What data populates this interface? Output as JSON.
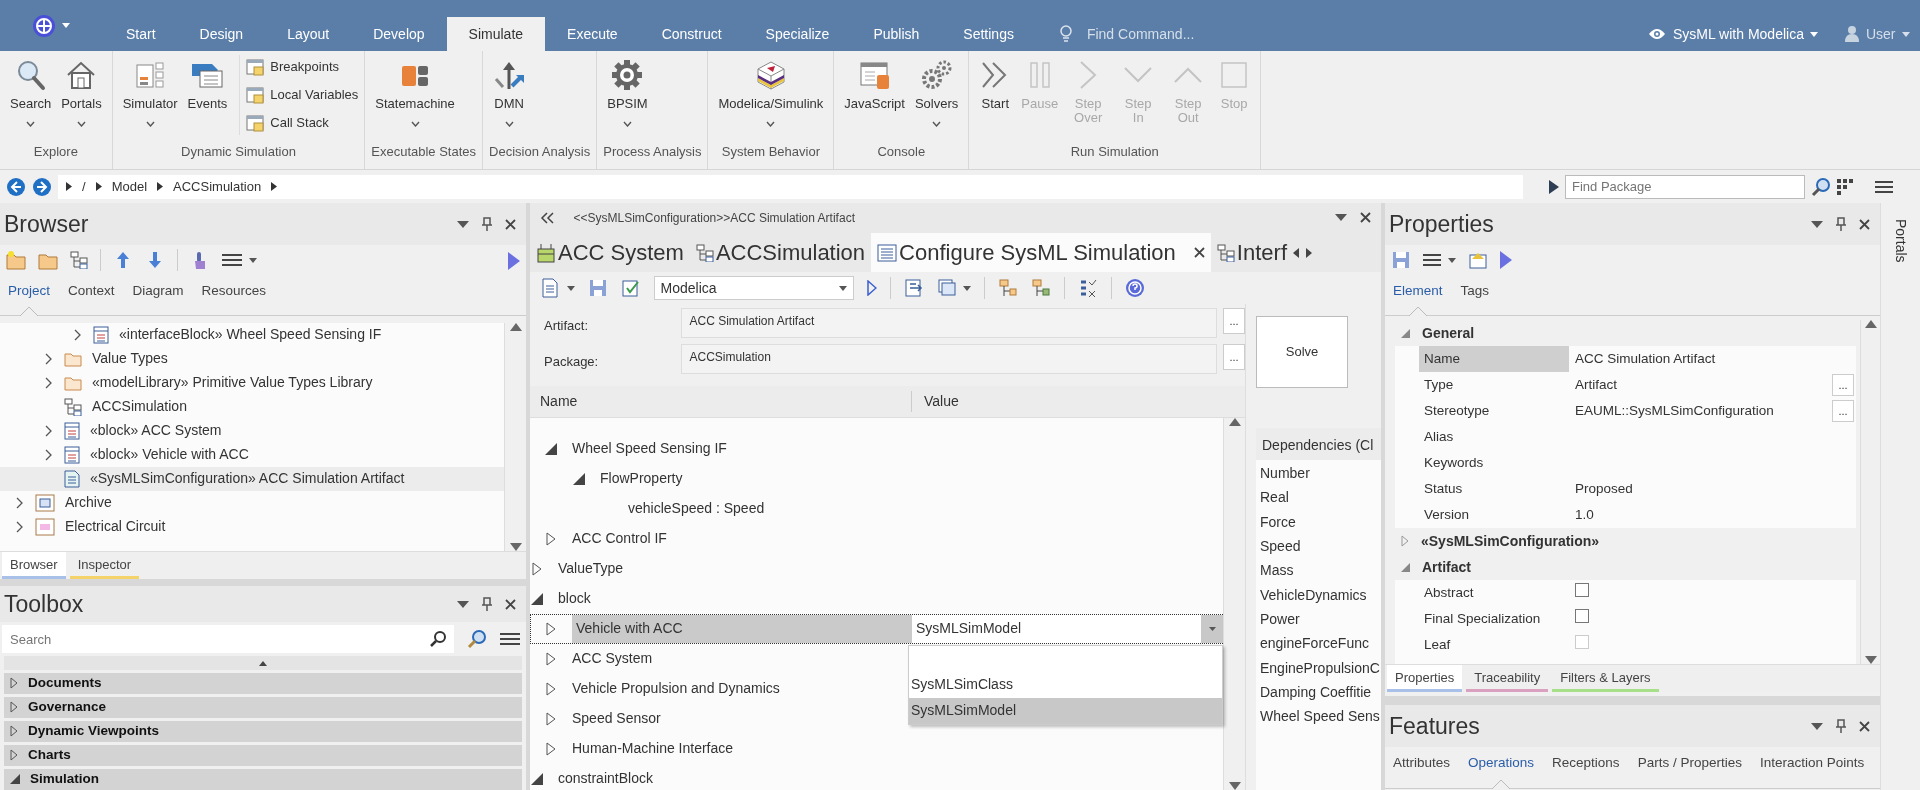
{
  "ribbon_tabs": [
    {
      "label": "Start",
      "selected": false
    },
    {
      "label": "Design",
      "selected": false
    },
    {
      "label": "Layout",
      "selected": false
    },
    {
      "label": "Develop",
      "selected": false
    },
    {
      "label": "Simulate",
      "selected": true
    },
    {
      "label": "Execute",
      "selected": false
    },
    {
      "label": "Construct",
      "selected": false
    },
    {
      "label": "Specialize",
      "selected": false
    },
    {
      "label": "Publish",
      "selected": false
    },
    {
      "label": "Settings",
      "selected": false
    }
  ],
  "find_command": {
    "placeholder": "Find Command..."
  },
  "perspective": "SysML with Modelica",
  "user": "User",
  "ribbon_groups": [
    {
      "label": "Explore",
      "items": [
        {
          "label": "Search",
          "kind": "large",
          "dropdown": true,
          "disabled": false
        },
        {
          "label": "Portals",
          "kind": "large",
          "dropdown": true,
          "disabled": false
        }
      ]
    },
    {
      "label": "Dynamic Simulation",
      "items": [
        {
          "label": "Simulator",
          "kind": "large",
          "dropdown": true,
          "disabled": false
        },
        {
          "label": "Events",
          "kind": "large",
          "dropdown": false,
          "disabled": false
        },
        {
          "label": "Breakpoints",
          "kind": "small",
          "disabled": false
        },
        {
          "label": "Local Variables",
          "kind": "small",
          "disabled": false
        },
        {
          "label": "Call Stack",
          "kind": "small",
          "disabled": false
        }
      ]
    },
    {
      "label": "Executable States",
      "items": [
        {
          "label": "Statemachine",
          "kind": "large",
          "dropdown": true,
          "disabled": false
        }
      ]
    },
    {
      "label": "Decision Analysis",
      "items": [
        {
          "label": "DMN",
          "kind": "large",
          "dropdown": true,
          "disabled": false
        }
      ]
    },
    {
      "label": "Process Analysis",
      "items": [
        {
          "label": "BPSIM",
          "kind": "large",
          "dropdown": true,
          "disabled": false
        }
      ]
    },
    {
      "label": "System Behavior",
      "items": [
        {
          "label": "Modelica/Simulink",
          "kind": "large",
          "dropdown": true,
          "disabled": false
        }
      ]
    },
    {
      "label": "Console",
      "items": [
        {
          "label": "JavaScript",
          "kind": "large",
          "dropdown": false,
          "disabled": false
        },
        {
          "label": "Solvers",
          "kind": "large",
          "dropdown": true,
          "disabled": false
        }
      ]
    },
    {
      "label": "Run Simulation",
      "items": [
        {
          "label": "Start",
          "kind": "large",
          "dropdown": false,
          "disabled": false
        },
        {
          "label": "Pause",
          "kind": "large",
          "dropdown": false,
          "disabled": true
        },
        {
          "label": "Step Over",
          "kind": "large",
          "dropdown": false,
          "disabled": true
        },
        {
          "label": "Step In",
          "kind": "large",
          "dropdown": false,
          "disabled": true
        },
        {
          "label": "Step Out",
          "kind": "large",
          "dropdown": false,
          "disabled": true
        },
        {
          "label": "Stop",
          "kind": "large",
          "dropdown": false,
          "disabled": true
        }
      ]
    }
  ],
  "breadcrumb": [
    "/",
    "Model",
    "ACCSimulation"
  ],
  "find_package": {
    "placeholder": "Find Package"
  },
  "browser": {
    "title": "Browser",
    "tabs": [
      {
        "label": "Project",
        "selected": true
      },
      {
        "label": "Context",
        "selected": false
      },
      {
        "label": "Diagram",
        "selected": false
      },
      {
        "label": "Resources",
        "selected": false
      }
    ],
    "tree": [
      {
        "children": [
          {
            "children": [
              {
                "label": "«interfaceBlock» Wheel Speed Sensing IF",
                "kind": "block",
                "expandable": true,
                "selected": false
              }
            ]
          },
          {
            "label": "Value Types",
            "kind": "folder",
            "expandable": true,
            "selected": false
          },
          {
            "label": "«modelLibrary» Primitive Value Types Library",
            "kind": "folder",
            "expandable": true,
            "selected": false
          },
          {
            "label": "ACCSimulation",
            "kind": "diagram",
            "expandable": false,
            "selected": false
          },
          {
            "label": "«block» ACC System",
            "kind": "block",
            "expandable": true,
            "selected": false
          },
          {
            "label": "«block» Vehicle with ACC",
            "kind": "block",
            "expandable": true,
            "selected": false
          },
          {
            "label": "«SysMLSimConfiguration» ACC Simulation Artifact",
            "kind": "artifact",
            "expandable": false,
            "selected": true
          }
        ]
      },
      {
        "label": "Archive",
        "kind": "package",
        "expandable": true,
        "selected": false
      },
      {
        "label": "Electrical Circuit",
        "kind": "model",
        "expandable": true,
        "selected": false
      }
    ],
    "bottom_tabs": [
      {
        "label": "Browser",
        "selected": true,
        "color": "#a9c1e8"
      },
      {
        "label": "Inspector",
        "selected": false,
        "color": "#f5d36b"
      }
    ]
  },
  "toolbox": {
    "title": "Toolbox",
    "search": {
      "placeholder": "Search"
    },
    "categories": [
      {
        "label": "Documents",
        "expanded": false
      },
      {
        "label": "Governance",
        "expanded": false
      },
      {
        "label": "Dynamic Viewpoints",
        "expanded": false
      },
      {
        "label": "Charts",
        "expanded": false
      },
      {
        "label": "Simulation",
        "expanded": true
      }
    ]
  },
  "editor": {
    "breadcrumb": "<<SysMLSimConfiguration>>ACC Simulation Artifact",
    "tabs": [
      {
        "label": "ACC System",
        "kind": "block",
        "selected": false
      },
      {
        "label": "ACCSimulation",
        "kind": "diagram",
        "selected": false
      },
      {
        "label": "Configure SysML Simulation",
        "kind": "config",
        "selected": true
      },
      {
        "label": "Interf",
        "kind": "diagram",
        "selected": false
      }
    ],
    "platform": "Modelica",
    "fields": [
      {
        "label": "Artifact:",
        "value": "ACC Simulation Artifact",
        "button": "..."
      },
      {
        "label": "Package:",
        "value": "ACCSimulation",
        "button": "..."
      }
    ],
    "columns": [
      "Name",
      "Value"
    ],
    "tree": [
      {
        "children": [
          {
            "label": "Wheel Speed Sensing IF",
            "expandable": true,
            "expanded": true,
            "selected": false,
            "children": [
              {
                "label": "FlowProperty",
                "expandable": true,
                "expanded": true,
                "selected": false,
                "children": [
                  {
                    "label": "vehicleSpeed : Speed",
                    "expandable": false,
                    "selected": false
                  }
                ]
              }
            ]
          },
          {
            "label": "ACC Control IF",
            "expandable": true,
            "expanded": false,
            "selected": false
          }
        ]
      },
      {
        "label": "ValueType",
        "expandable": true,
        "expanded": false,
        "selected": false
      },
      {
        "label": "block",
        "expandable": true,
        "expanded": true,
        "selected": false,
        "children": [
          {
            "label": "Vehicle with ACC",
            "expandable": true,
            "expanded": false,
            "selected": true,
            "value": "SysMLSimModel",
            "dropdown": {
              "options": [
                {
                  "label": "SysMLSimClass",
                  "selected": false
                },
                {
                  "label": "SysMLSimModel",
                  "selected": true
                }
              ]
            }
          },
          {
            "label": "ACC System",
            "expandable": true,
            "expanded": false,
            "selected": false
          },
          {
            "label": "Vehicle Propulsion and Dynamics",
            "expandable": true,
            "expanded": false,
            "selected": false
          },
          {
            "label": "Speed Sensor",
            "expandable": true,
            "expanded": false,
            "selected": false
          },
          {
            "label": "Human-Machine Interface",
            "expandable": true,
            "expanded": false,
            "selected": false
          }
        ]
      },
      {
        "label": "constraintBlock",
        "expandable": true,
        "expanded": true,
        "selected": false
      }
    ],
    "solve": "Solve",
    "dependencies": {
      "title": "Dependencies (Cl",
      "items": [
        "Number",
        "Real",
        "Force",
        "Speed",
        "Mass",
        "VehicleDynamics",
        "Power",
        "engineForceFunc",
        "EnginePropulsionC",
        "Damping Coeffitie",
        "Wheel Speed Sens"
      ]
    }
  },
  "properties": {
    "title": "Properties",
    "tabs": [
      {
        "label": "Element",
        "selected": true
      },
      {
        "label": "Tags",
        "selected": false
      }
    ],
    "sections": [
      {
        "label": "General",
        "expanded": true,
        "rows": [
          {
            "name": "Name",
            "value": "ACC Simulation Artifact",
            "kind": "text",
            "selected": true
          },
          {
            "name": "Type",
            "value": "Artifact",
            "kind": "text",
            "selected": false,
            "button": "..."
          },
          {
            "name": "Stereotype",
            "value": "EAUML::SysMLSimConfiguration",
            "kind": "text",
            "selected": false,
            "button": "..."
          },
          {
            "name": "Alias",
            "kind": "text",
            "selected": false
          },
          {
            "name": "Keywords",
            "kind": "text",
            "selected": false
          },
          {
            "name": "Status",
            "value": "Proposed",
            "kind": "text",
            "selected": false
          },
          {
            "name": "Version",
            "value": "1.0",
            "kind": "text",
            "selected": false
          }
        ]
      },
      {
        "label": "«SysMLSimConfiguration»",
        "expanded": false
      },
      {
        "label": "Artifact",
        "expanded": true,
        "rows": [
          {
            "name": "Abstract",
            "kind": "checkbox",
            "checked": false,
            "disabled": false,
            "selected": false
          },
          {
            "name": "Final Specialization",
            "kind": "checkbox",
            "checked": false,
            "disabled": false,
            "selected": false
          },
          {
            "name": "Leaf",
            "kind": "checkbox",
            "checked": false,
            "disabled": true,
            "selected": false
          }
        ]
      }
    ],
    "bottom_tabs": [
      {
        "label": "Properties",
        "selected": true,
        "color": "#a9c1e8"
      },
      {
        "label": "Traceability",
        "selected": false,
        "color": "#d9a0c0"
      },
      {
        "label": "Filters & Layers",
        "selected": false,
        "color": "#a8e08a"
      }
    ]
  },
  "features": {
    "title": "Features",
    "tabs": [
      {
        "label": "Attributes",
        "selected": false
      },
      {
        "label": "Operations",
        "selected": true
      },
      {
        "label": "Receptions",
        "selected": false
      },
      {
        "label": "Parts / Properties",
        "selected": false
      },
      {
        "label": "Interaction Points",
        "selected": false
      }
    ]
  },
  "portals": "Portals"
}
